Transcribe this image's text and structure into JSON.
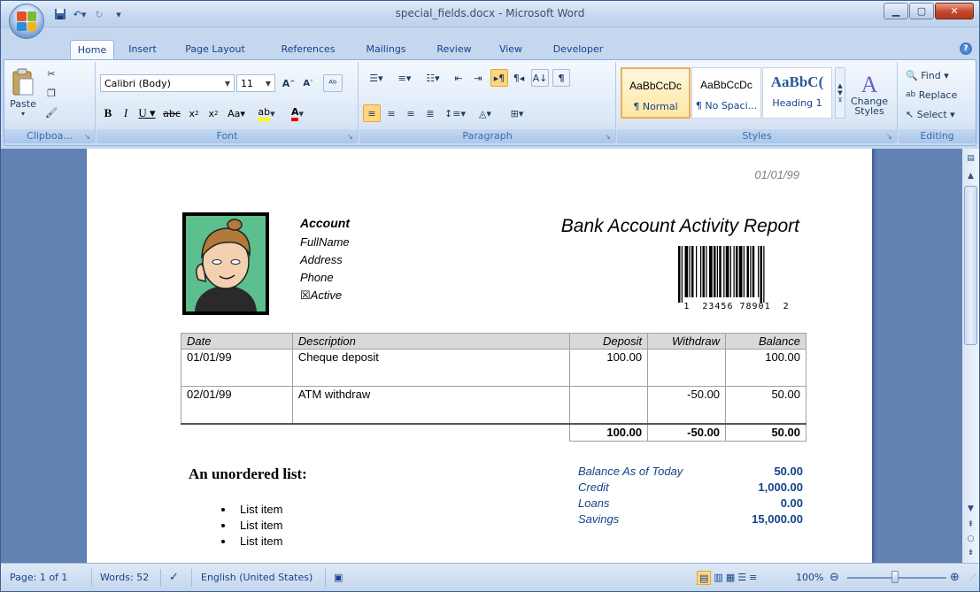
{
  "window": {
    "title": "special_fields.docx - Microsoft Word"
  },
  "tabs": [
    "Home",
    "Insert",
    "Page Layout",
    "References",
    "Mailings",
    "Review",
    "View",
    "Developer"
  ],
  "ribbon": {
    "clipboard": {
      "label": "Clipboa...",
      "paste": "Paste"
    },
    "font": {
      "label": "Font",
      "family": "Calibri (Body)",
      "size": "11"
    },
    "paragraph": {
      "label": "Paragraph"
    },
    "styles": {
      "label": "Styles",
      "items": [
        {
          "sample": "AaBbCcDc",
          "name": "¶ Normal"
        },
        {
          "sample": "AaBbCcDc",
          "name": "¶ No Spaci..."
        },
        {
          "sample": "AaBbC(",
          "name": "Heading 1"
        }
      ],
      "change_styles": "Change Styles"
    },
    "editing": {
      "label": "Editing",
      "find": "Find",
      "replace": "Replace",
      "select": "Select"
    }
  },
  "document": {
    "date": "01/01/99",
    "report_title": "Bank Account Activity Report",
    "account": {
      "heading": "Account",
      "full_name": "FullName",
      "address": "Address",
      "phone": "Phone",
      "active_mark": "☒",
      "active": "Active"
    },
    "barcode_text": "1  23456 78901  2",
    "table": {
      "headers": [
        "Date",
        "Description",
        "Deposit",
        "Withdraw",
        "Balance"
      ],
      "rows": [
        [
          "01/01/99",
          "Cheque deposit",
          "100.00",
          "",
          "100.00"
        ],
        [
          "02/01/99",
          "ATM withdraw",
          "",
          "-50.00",
          "50.00"
        ]
      ],
      "totals": [
        "100.00",
        "-50.00",
        "50.00"
      ]
    },
    "list_heading": "An unordered list:",
    "list_items": [
      "List item",
      "List item",
      "List item"
    ],
    "summary": [
      {
        "label": "Balance As of Today",
        "value": "50.00"
      },
      {
        "label": "Credit",
        "value": "1,000.00"
      },
      {
        "label": "Loans",
        "value": "0.00"
      },
      {
        "label": "Savings",
        "value": "15,000.00"
      }
    ]
  },
  "status": {
    "page": "Page: 1 of 1",
    "words": "Words: 52",
    "language": "English (United States)",
    "zoom": "100%"
  }
}
